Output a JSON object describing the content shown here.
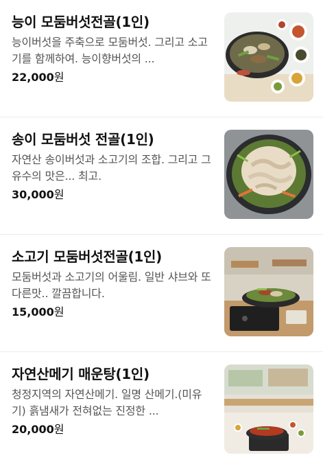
{
  "menu": {
    "items": [
      {
        "name": "능이 모둠버섯전골(1인)",
        "description": "능이버섯을 주축으로 모둠버섯. 그리고 소고기를 함께하여. 능이향버섯의 ...",
        "price": "22,000",
        "currency": "원",
        "image": "mushroom-hotpot-photo"
      },
      {
        "name": "송이 모둠버섯 전골(1인)",
        "description": "자연산 송이버섯과 소고기의 조합. 그리고 그 유수의 맛은... 최고.",
        "price": "30,000",
        "currency": "원",
        "image": "songi-hotpot-photo"
      },
      {
        "name": "소고기 모둠버섯전골(1인)",
        "description": "모둠버섯과 소고기의 어울림. 일반 샤브와 또다른맛.. 깔끔합니다.",
        "price": "15,000",
        "currency": "원",
        "image": "beef-hotpot-photo"
      },
      {
        "name": "자연산메기 매운탕(1인)",
        "description": "청정지역의 자연산메기. 일명 산메기.(미유기) 흙냄새가 전혀없는 진정한 ...",
        "price": "20,000",
        "currency": "원",
        "image": "catfish-stew-photo"
      }
    ]
  }
}
